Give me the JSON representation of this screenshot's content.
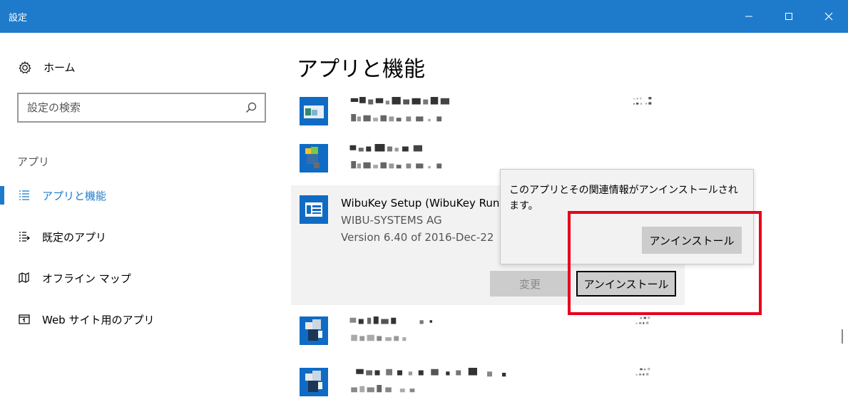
{
  "window": {
    "title": "設定",
    "controls": {
      "minimize": "—",
      "maximize": "☐",
      "close": "✕"
    },
    "accent": "#1e7bcc"
  },
  "sidebar": {
    "home_label": "ホーム",
    "search_placeholder": "設定の検索",
    "section_label": "アプリ",
    "items": [
      {
        "label": "アプリと機能",
        "icon": "list-icon",
        "active": true
      },
      {
        "label": "既定のアプリ",
        "icon": "default-apps-icon",
        "active": false
      },
      {
        "label": "オフライン マップ",
        "icon": "map-icon",
        "active": false
      },
      {
        "label": "Web サイト用のアプリ",
        "icon": "web-apps-icon",
        "active": false
      }
    ]
  },
  "main": {
    "title": "アプリと機能",
    "expanded_app": {
      "name": "WibuKey Setup (WibuKey Runtime for Windows)",
      "publisher": "WIBU-SYSTEMS AG",
      "version": "Version 6.40 of 2016-Dec-22",
      "change_label": "変更",
      "uninstall_label": "アンインストール"
    },
    "flyout": {
      "message": "このアプリとその関連情報がアンインストールされます。",
      "uninstall_label": "アンインストール"
    }
  }
}
